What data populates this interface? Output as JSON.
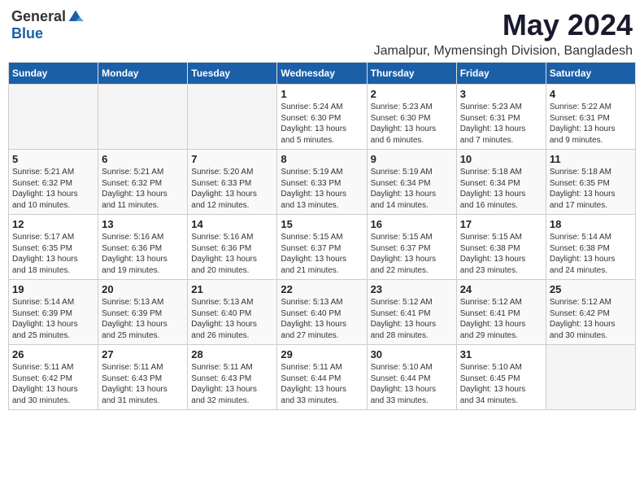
{
  "logo": {
    "general": "General",
    "blue": "Blue"
  },
  "title": "May 2024",
  "subtitle": "Jamalpur, Mymensingh Division, Bangladesh",
  "weekdays": [
    "Sunday",
    "Monday",
    "Tuesday",
    "Wednesday",
    "Thursday",
    "Friday",
    "Saturday"
  ],
  "weeks": [
    [
      {
        "day": "",
        "info": ""
      },
      {
        "day": "",
        "info": ""
      },
      {
        "day": "",
        "info": ""
      },
      {
        "day": "1",
        "info": "Sunrise: 5:24 AM\nSunset: 6:30 PM\nDaylight: 13 hours\nand 5 minutes."
      },
      {
        "day": "2",
        "info": "Sunrise: 5:23 AM\nSunset: 6:30 PM\nDaylight: 13 hours\nand 6 minutes."
      },
      {
        "day": "3",
        "info": "Sunrise: 5:23 AM\nSunset: 6:31 PM\nDaylight: 13 hours\nand 7 minutes."
      },
      {
        "day": "4",
        "info": "Sunrise: 5:22 AM\nSunset: 6:31 PM\nDaylight: 13 hours\nand 9 minutes."
      }
    ],
    [
      {
        "day": "5",
        "info": "Sunrise: 5:21 AM\nSunset: 6:32 PM\nDaylight: 13 hours\nand 10 minutes."
      },
      {
        "day": "6",
        "info": "Sunrise: 5:21 AM\nSunset: 6:32 PM\nDaylight: 13 hours\nand 11 minutes."
      },
      {
        "day": "7",
        "info": "Sunrise: 5:20 AM\nSunset: 6:33 PM\nDaylight: 13 hours\nand 12 minutes."
      },
      {
        "day": "8",
        "info": "Sunrise: 5:19 AM\nSunset: 6:33 PM\nDaylight: 13 hours\nand 13 minutes."
      },
      {
        "day": "9",
        "info": "Sunrise: 5:19 AM\nSunset: 6:34 PM\nDaylight: 13 hours\nand 14 minutes."
      },
      {
        "day": "10",
        "info": "Sunrise: 5:18 AM\nSunset: 6:34 PM\nDaylight: 13 hours\nand 16 minutes."
      },
      {
        "day": "11",
        "info": "Sunrise: 5:18 AM\nSunset: 6:35 PM\nDaylight: 13 hours\nand 17 minutes."
      }
    ],
    [
      {
        "day": "12",
        "info": "Sunrise: 5:17 AM\nSunset: 6:35 PM\nDaylight: 13 hours\nand 18 minutes."
      },
      {
        "day": "13",
        "info": "Sunrise: 5:16 AM\nSunset: 6:36 PM\nDaylight: 13 hours\nand 19 minutes."
      },
      {
        "day": "14",
        "info": "Sunrise: 5:16 AM\nSunset: 6:36 PM\nDaylight: 13 hours\nand 20 minutes."
      },
      {
        "day": "15",
        "info": "Sunrise: 5:15 AM\nSunset: 6:37 PM\nDaylight: 13 hours\nand 21 minutes."
      },
      {
        "day": "16",
        "info": "Sunrise: 5:15 AM\nSunset: 6:37 PM\nDaylight: 13 hours\nand 22 minutes."
      },
      {
        "day": "17",
        "info": "Sunrise: 5:15 AM\nSunset: 6:38 PM\nDaylight: 13 hours\nand 23 minutes."
      },
      {
        "day": "18",
        "info": "Sunrise: 5:14 AM\nSunset: 6:38 PM\nDaylight: 13 hours\nand 24 minutes."
      }
    ],
    [
      {
        "day": "19",
        "info": "Sunrise: 5:14 AM\nSunset: 6:39 PM\nDaylight: 13 hours\nand 25 minutes."
      },
      {
        "day": "20",
        "info": "Sunrise: 5:13 AM\nSunset: 6:39 PM\nDaylight: 13 hours\nand 25 minutes."
      },
      {
        "day": "21",
        "info": "Sunrise: 5:13 AM\nSunset: 6:40 PM\nDaylight: 13 hours\nand 26 minutes."
      },
      {
        "day": "22",
        "info": "Sunrise: 5:13 AM\nSunset: 6:40 PM\nDaylight: 13 hours\nand 27 minutes."
      },
      {
        "day": "23",
        "info": "Sunrise: 5:12 AM\nSunset: 6:41 PM\nDaylight: 13 hours\nand 28 minutes."
      },
      {
        "day": "24",
        "info": "Sunrise: 5:12 AM\nSunset: 6:41 PM\nDaylight: 13 hours\nand 29 minutes."
      },
      {
        "day": "25",
        "info": "Sunrise: 5:12 AM\nSunset: 6:42 PM\nDaylight: 13 hours\nand 30 minutes."
      }
    ],
    [
      {
        "day": "26",
        "info": "Sunrise: 5:11 AM\nSunset: 6:42 PM\nDaylight: 13 hours\nand 30 minutes."
      },
      {
        "day": "27",
        "info": "Sunrise: 5:11 AM\nSunset: 6:43 PM\nDaylight: 13 hours\nand 31 minutes."
      },
      {
        "day": "28",
        "info": "Sunrise: 5:11 AM\nSunset: 6:43 PM\nDaylight: 13 hours\nand 32 minutes."
      },
      {
        "day": "29",
        "info": "Sunrise: 5:11 AM\nSunset: 6:44 PM\nDaylight: 13 hours\nand 33 minutes."
      },
      {
        "day": "30",
        "info": "Sunrise: 5:10 AM\nSunset: 6:44 PM\nDaylight: 13 hours\nand 33 minutes."
      },
      {
        "day": "31",
        "info": "Sunrise: 5:10 AM\nSunset: 6:45 PM\nDaylight: 13 hours\nand 34 minutes."
      },
      {
        "day": "",
        "info": ""
      }
    ]
  ]
}
